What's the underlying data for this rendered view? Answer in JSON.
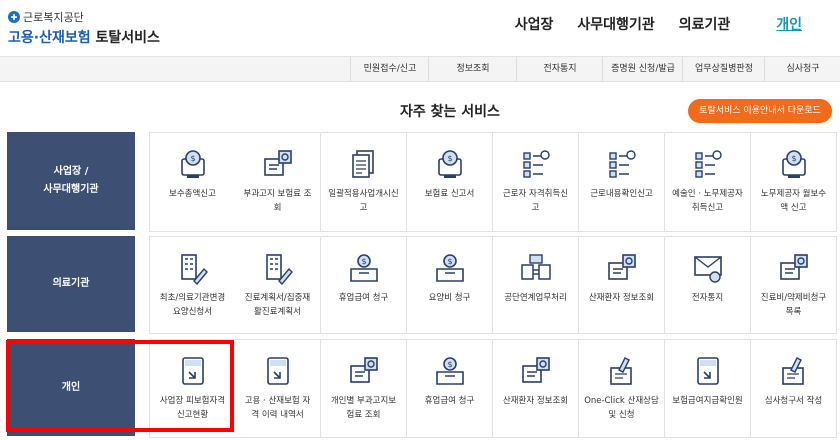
{
  "header": {
    "org": "근로복지공단",
    "title_part1": "고용·산재보험",
    "title_part2": "토탈서비스",
    "nav": [
      "사업장",
      "사무대행기관",
      "의료기관"
    ],
    "nav_active": "개인"
  },
  "subbar": [
    "민원접수/신고",
    "정보조회",
    "전자통지",
    "증명원 신청/발급",
    "업무상질병판정",
    "심사청구"
  ],
  "section": {
    "title": "자주 찾는 서비스",
    "download_label": "토탈서비스 이용안내서 다운로드"
  },
  "rows": [
    {
      "label": "사업장 /\n사무대행기관",
      "items": [
        {
          "label": "보수총액신고",
          "icon": "monitor-coin-icon"
        },
        {
          "label": "부과고지 보험료 조\n회",
          "icon": "document-search-icon"
        },
        {
          "label": "일괄적용사업개시신\n고",
          "icon": "document-stack-icon"
        },
        {
          "label": "보험료 신고서",
          "icon": "monitor-coin-icon"
        },
        {
          "label": "근로자 자격취득신\n고",
          "icon": "checklist-icon"
        },
        {
          "label": "근로내용확인신고",
          "icon": "checklist-icon"
        },
        {
          "label": "예술인 · 노무제공자\n취득신고",
          "icon": "checklist-icon"
        },
        {
          "label": "노무제공자 월보수\n액 신고",
          "icon": "monitor-coin-icon"
        }
      ]
    },
    {
      "label": "의료기관",
      "items": [
        {
          "label": "최초/의료기관변경\n요양신청서",
          "icon": "building-pen-icon"
        },
        {
          "label": "진료계획서/집중재\n활진료계획서",
          "icon": "building-pen-icon"
        },
        {
          "label": "휴업급여 청구",
          "icon": "coin-box-icon"
        },
        {
          "label": "요양비 청구",
          "icon": "coin-box-icon"
        },
        {
          "label": "공단연계업무처리",
          "icon": "exchange-icon"
        },
        {
          "label": "산재환자 정보조회",
          "icon": "document-search-icon"
        },
        {
          "label": "전자통지",
          "icon": "mail-box-icon"
        },
        {
          "label": "진료비/약제비청구\n목록",
          "icon": "document-search-icon"
        }
      ]
    },
    {
      "label": "개인",
      "items": [
        {
          "label": "사업장 피보험자격\n신고현황",
          "icon": "download-doc-icon"
        },
        {
          "label": "고용 · 산재보험 자\n격 이력 내역서",
          "icon": "download-doc-icon"
        },
        {
          "label": "개인별 부과고지보\n험료 조회",
          "icon": "document-search-icon"
        },
        {
          "label": "휴업급여 청구",
          "icon": "coin-box-icon"
        },
        {
          "label": "산재환자 정보조회",
          "icon": "document-search-icon"
        },
        {
          "label": "One-Click 산재상담\n및 신청",
          "icon": "pen-doc-icon"
        },
        {
          "label": "보험급여지급확인원",
          "icon": "download-doc-icon"
        },
        {
          "label": "심사청구서 작성",
          "icon": "pen-doc-icon"
        }
      ]
    }
  ],
  "colors": {
    "row_label_bg": "#3d4f72",
    "accent_orange": "#f26a1b",
    "brand_blue": "#1a5fb4",
    "nav_active": "#1496b4",
    "highlight": "#ff0000"
  }
}
